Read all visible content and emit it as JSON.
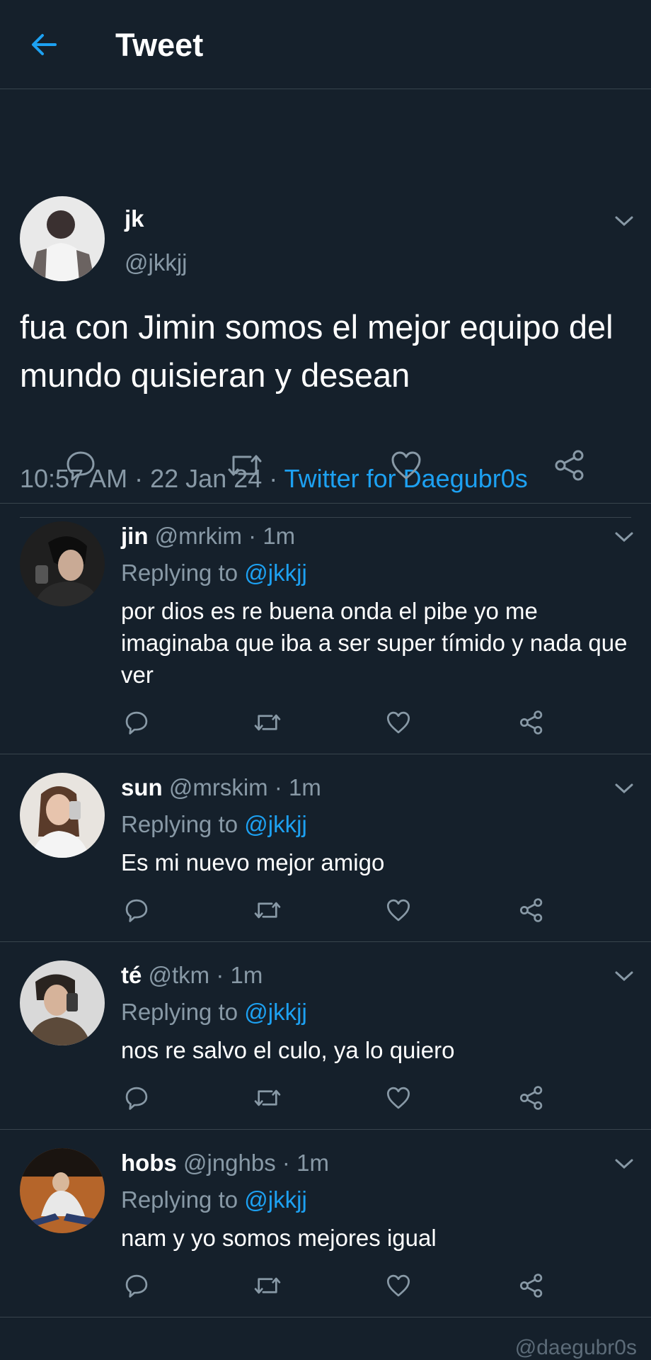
{
  "header": {
    "title": "Tweet"
  },
  "main_tweet": {
    "name": "jk",
    "handle": "@jkkjj",
    "text": "fua con Jimin somos el mejor equipo del mundo quisieran y desean",
    "time": "10:57 AM",
    "date": "22 Jan 24",
    "source": "Twitter for Daegubr0s"
  },
  "replies": [
    {
      "name": "jin",
      "handle": "@mrkim",
      "time": "1m",
      "replying_label": "Replying to",
      "replying_to": "@jkkjj",
      "text": "por dios es re buena onda el pibe yo me imaginaba que iba a ser super tímido y nada que ver"
    },
    {
      "name": "sun",
      "handle": "@mrskim",
      "time": "1m",
      "replying_label": "Replying to",
      "replying_to": "@jkkjj",
      "text": "Es mi nuevo mejor amigo"
    },
    {
      "name": "té",
      "handle": "@tkm",
      "time": "1m",
      "replying_label": "Replying to",
      "replying_to": "@jkkjj",
      "text": "nos re salvo el culo, ya lo quiero"
    },
    {
      "name": "hobs",
      "handle": "@jnghbs",
      "time": "1m",
      "replying_label": "Replying to",
      "replying_to": "@jkkjj",
      "text": "nam y yo somos mejores igual"
    }
  ],
  "watermark": "@daegubr0s",
  "colors": {
    "background": "#15202b",
    "accent": "#1da1f2",
    "secondary_text": "#8899a6",
    "divider": "#38444d"
  },
  "icons": [
    "back-arrow-icon",
    "chevron-down-icon",
    "reply-icon",
    "retweet-icon",
    "like-icon",
    "share-icon"
  ]
}
